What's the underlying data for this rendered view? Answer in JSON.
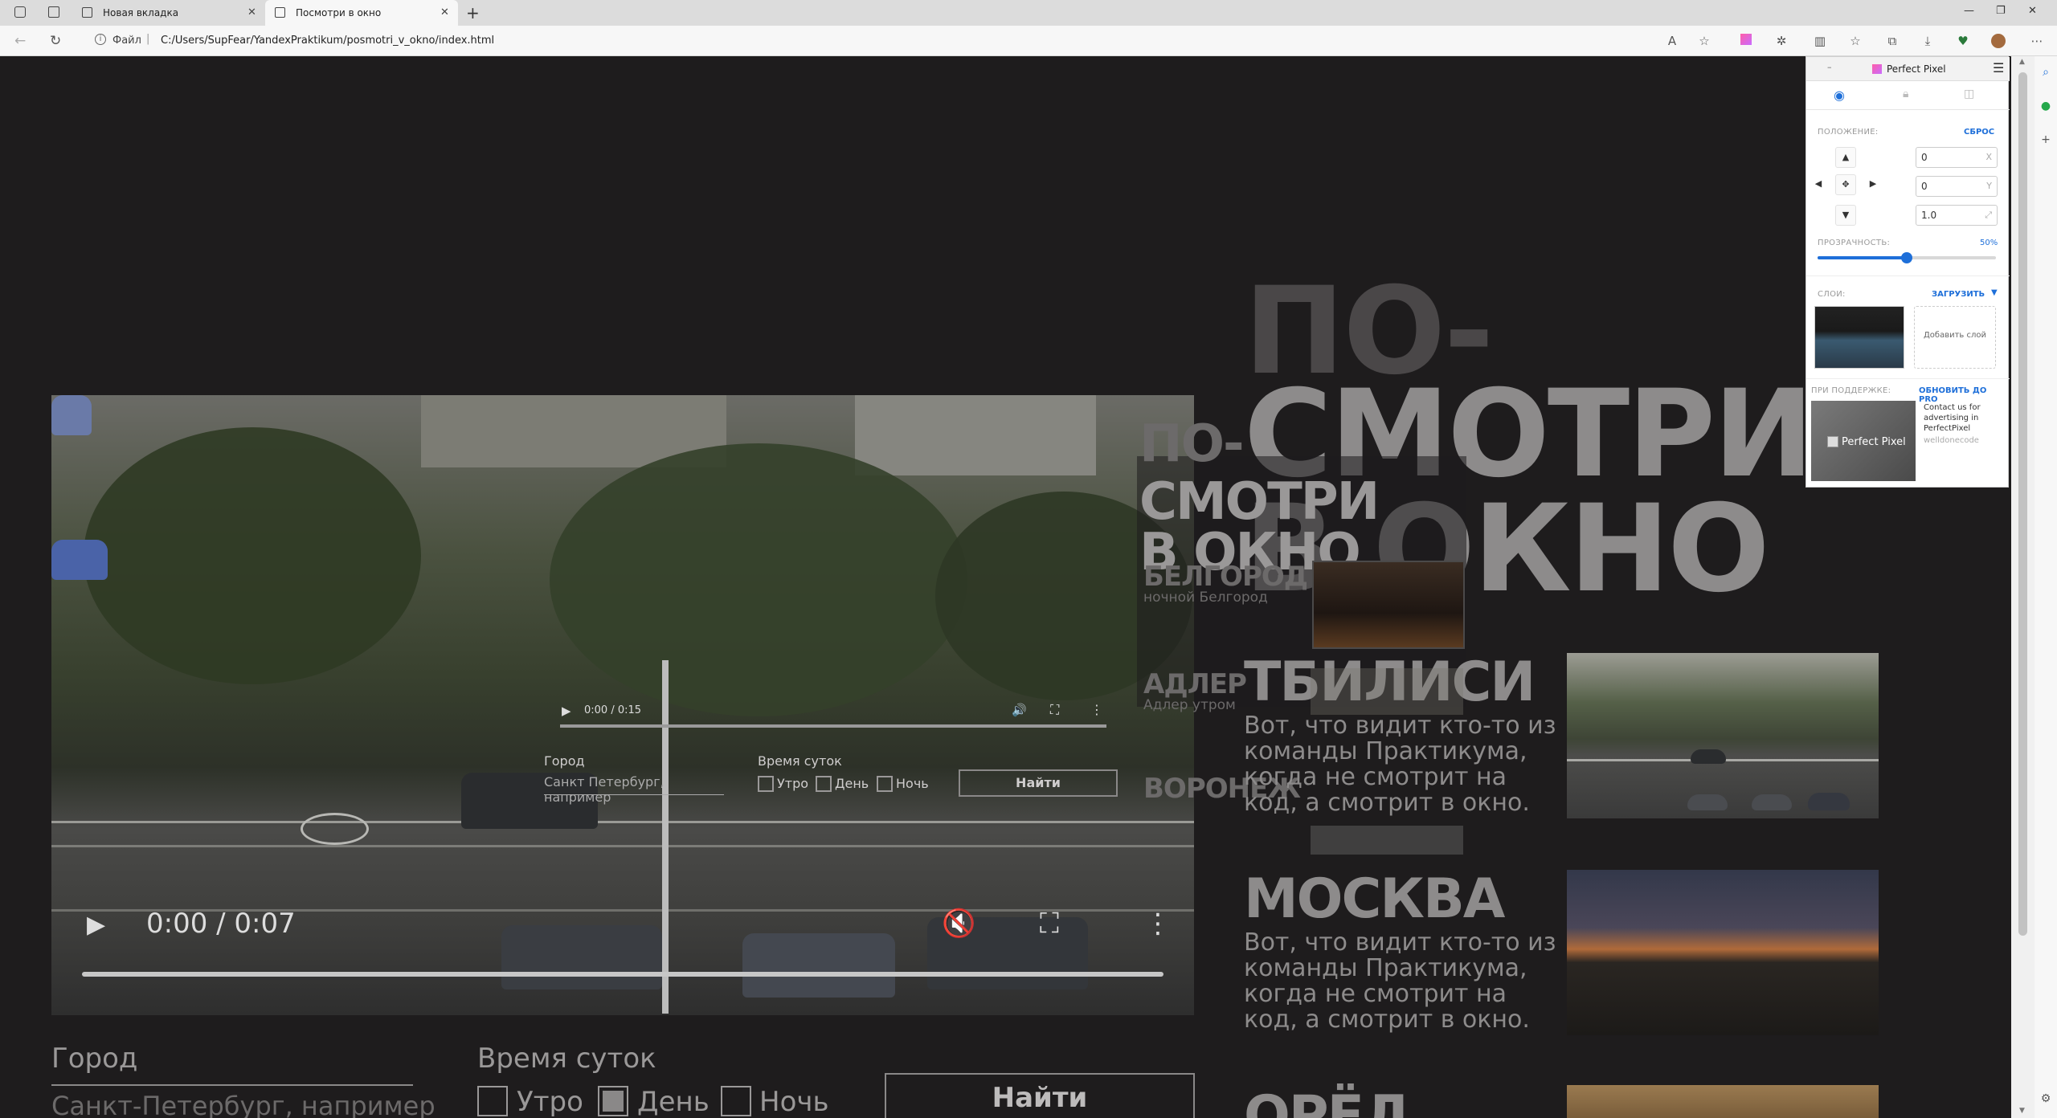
{
  "browser": {
    "tabs": [
      {
        "title": "Новая вкладка"
      },
      {
        "title": "Посмотри в окно"
      }
    ],
    "address": {
      "scheme_label": "Файл",
      "path": "C:/Users/SupFear/YandexPraktikum/posmotri_v_okno/index.html"
    }
  },
  "page": {
    "hero_lines": [
      "ПО-",
      "СМОТРИ",
      "В ОКНО"
    ],
    "hero_small_lines": [
      "ПО-",
      "СМОТРИ",
      "В ОКНО"
    ],
    "cities_small": [
      {
        "name": "БЕЛГОРОД",
        "subtitle": "ночной Белгород"
      },
      {
        "name": "АДЛЕР",
        "subtitle": "Адлер утром"
      },
      {
        "name": "ВОРОНЕЖ",
        "subtitle": ""
      }
    ],
    "cards": [
      {
        "name": "ТБИЛИСИ",
        "text": "Вот, что видит кто-то из команды Практикума, когда не смотрит на код, а смотрит в окно."
      },
      {
        "name": "МОСКВА",
        "text": "Вот, что видит кто-то из команды Практикума, когда не смотрит на код, а смотрит в окно."
      },
      {
        "name": "ОРЁЛ",
        "text": ""
      }
    ],
    "video_big": {
      "time": "0:00 / 0:07"
    },
    "video_small": {
      "time": "0:00 / 0:15"
    },
    "form": {
      "city_label": "Город",
      "city_placeholder": "Санкт-Петербург, например",
      "time_label": "Время суток",
      "options": [
        "Утро",
        "День",
        "Ночь"
      ],
      "selected": "День",
      "submit": "Найти"
    },
    "form_small": {
      "city_label": "Город",
      "city_placeholder": "Санкт Петербург, например",
      "time_label": "Время суток",
      "options": [
        "Утро",
        "День",
        "Ночь"
      ],
      "submit": "Найти"
    }
  },
  "perfect_pixel": {
    "title": "Perfect Pixel",
    "position_label": "ПОЛОЖЕНИЕ:",
    "reset": "СБРОС",
    "x": "0",
    "x_suffix": "X",
    "y": "0",
    "y_suffix": "Y",
    "scale": "1.0",
    "opacity_label": "ПРОЗРАЧНОСТЬ:",
    "opacity_value": "50%",
    "opacity_fraction": 0.5,
    "layers_label": "СЛОИ:",
    "upload": "ЗАГРУЗИТЬ",
    "add_layer": "Добавить слой",
    "support_label": "ПРИ ПОДДЕРЖКЕ:",
    "upgrade": "ОБНОВИТЬ ДО PRO",
    "ad_logo": "Perfect Pixel",
    "ad_text": "Contact us for advertising in PerfectPixel",
    "ad_link": "welldonecode"
  },
  "colors": {
    "page_bg": "#1e1c1d",
    "hero": "#8d8b8b",
    "accent": "#1e6fd9"
  }
}
